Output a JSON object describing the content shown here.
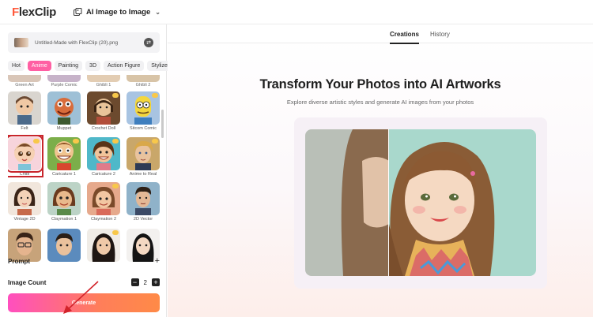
{
  "topbar": {
    "logo_first": "F",
    "logo_rest": "lexClip",
    "mode_label": "AI Image to Image"
  },
  "sidebar": {
    "file_name": "Untitled-Made with FlexClip (20).png",
    "categories": [
      {
        "label": "Hot",
        "active": false
      },
      {
        "label": "Anime",
        "active": true
      },
      {
        "label": "Painting",
        "active": false
      },
      {
        "label": "3D",
        "active": false
      },
      {
        "label": "Action Figure",
        "active": false
      },
      {
        "label": "Stylize",
        "active": false
      }
    ],
    "partial_row": [
      "Green Art",
      "Purple Comic",
      "Ghibli 1",
      "Ghibli 2"
    ],
    "styles_row1": [
      "Felt",
      "Muppet",
      "Crochet Doll",
      "Sitcom Comic"
    ],
    "styles_row2": [
      "Chibi",
      "Caricature 1",
      "Caricature 2",
      "Anime to Real"
    ],
    "styles_row3": [
      "Vintage 2D",
      "Claymation 1",
      "Claymation 2",
      "2D Vector"
    ],
    "prompt_label": "Prompt",
    "image_count_label": "Image Count",
    "image_count_value": "2",
    "generate_label": "Generate"
  },
  "main": {
    "tabs": [
      {
        "label": "Creations",
        "active": true
      },
      {
        "label": "History",
        "active": false
      }
    ],
    "headline": "Transform Your Photos into AI Artworks",
    "subheadline": "Explore diverse artistic styles and generate AI images from your photos"
  },
  "colors": {
    "accent": "#ff5fa3",
    "selection": "#c8262c",
    "generate_start": "#ff4fbf",
    "generate_end": "#ff8a47"
  }
}
